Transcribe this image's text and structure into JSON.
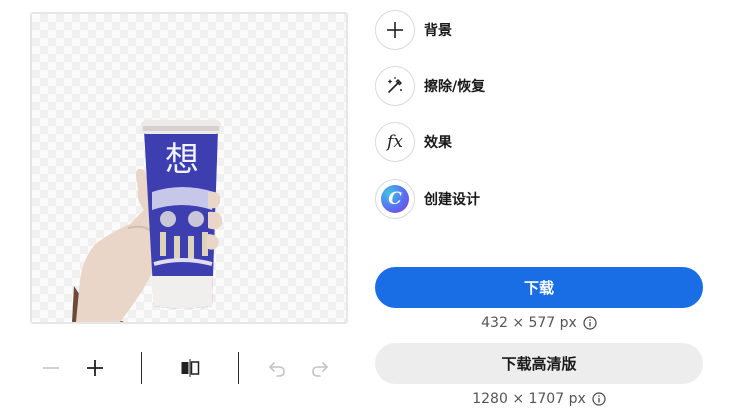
{
  "actions": [
    {
      "label": "背景",
      "icon": "plus-icon"
    },
    {
      "label": "擦除/恢复",
      "icon": "magic-brush-icon"
    },
    {
      "label": "效果",
      "icon": "fx-icon",
      "glyph": "fx"
    },
    {
      "label": "创建设计",
      "icon": "canva-logo-icon",
      "glyph": "C"
    }
  ],
  "download": {
    "primary_label": "下载",
    "primary_dimensions": "432 × 577 px",
    "hd_label": "下载高清版",
    "hd_dimensions": "1280 × 1707 px"
  },
  "preview": {
    "cup_text": "想"
  },
  "toolbar": {
    "buttons": [
      "zoom-out-icon",
      "zoom-in-icon",
      "flip-horizontal-icon",
      "undo-icon",
      "redo-icon"
    ]
  },
  "colors": {
    "primary": "#1a6ee5",
    "secondary_bg": "#ededed",
    "cup_blue": "#3d3fb0"
  }
}
